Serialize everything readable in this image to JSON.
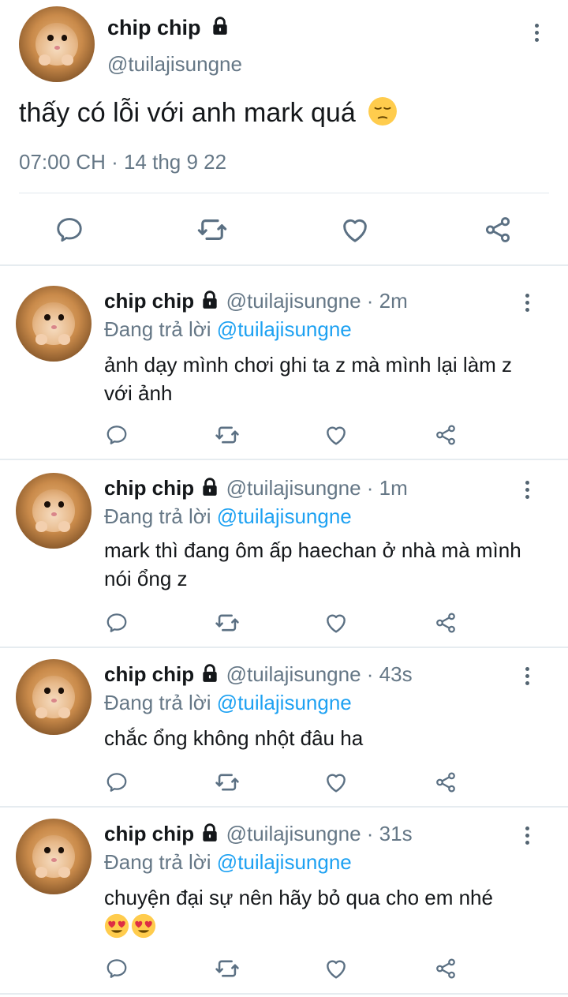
{
  "main_tweet": {
    "display_name": "chip chip",
    "handle": "@tuilajisungne",
    "text": "thấy có lỗi với anh mark quá",
    "emoji": "😔",
    "timestamp": "07:00 CH · 14 thg 9 22",
    "icons": [
      "lock-icon",
      "more-icon",
      "reply-icon",
      "retweet-icon",
      "like-icon",
      "share-icon"
    ]
  },
  "replies": [
    {
      "display_name": "chip chip",
      "handle": "@tuilajisungne",
      "time": "· 2m",
      "replying_label": "Đang trả lời",
      "replying_to": "@tuilajisungne",
      "text": "ảnh dạy mình chơi ghi ta z mà mình lại làm z với ảnh"
    },
    {
      "display_name": "chip chip",
      "handle": "@tuilajisungne",
      "time": "· 1m",
      "replying_label": "Đang trả lời",
      "replying_to": "@tuilajisungne",
      "text": "mark thì đang ôm ấp haechan ở nhà mà mình nói ổng z"
    },
    {
      "display_name": "chip chip",
      "handle": "@tuilajisungne",
      "time": "· 43s",
      "replying_label": "Đang trả lời",
      "replying_to": "@tuilajisungne",
      "text": "chắc ổng không nhột đâu ha"
    },
    {
      "display_name": "chip chip",
      "handle": "@tuilajisungne",
      "time": "· 31s",
      "replying_label": "Đang trả lời",
      "replying_to": "@tuilajisungne",
      "text": "chuyện đại sự nên hãy bỏ qua cho em nhé",
      "emoji": "😍😍"
    }
  ],
  "colors": {
    "text": "#14171a",
    "secondary": "#657786",
    "link": "#1da1f2",
    "icon": "#5b7083",
    "divider": "#e1e8ed"
  }
}
